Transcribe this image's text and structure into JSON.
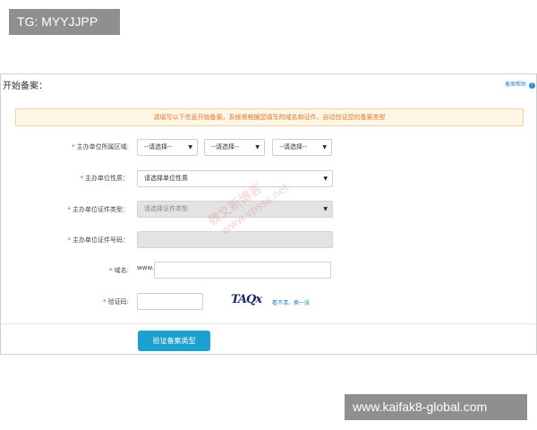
{
  "overlay": {
    "tg_label": "TG: MYYJJPP",
    "site_label": "www.kaifak8-global.com"
  },
  "header": {
    "title": "开始备案：",
    "help_label": "备案帮助",
    "help_icon": "?"
  },
  "notice": {
    "text": "请填写以下信息开始备案，系统将根据您填写的域名和证件，自动验证您的备案类型"
  },
  "form": {
    "required_mark": "*",
    "region": {
      "label": "主办单位所属区域:",
      "selects": [
        "--请选择--",
        "--请选择--",
        "--请选择--"
      ]
    },
    "unit_nature": {
      "label": "主办单位性质：",
      "value": "请选择单位性质"
    },
    "cert_type": {
      "label": "主办单位证件类型：",
      "value": "请选择证件类型"
    },
    "cert_number": {
      "label": "主办单位证件号码：",
      "value": ""
    },
    "domain": {
      "label": "域名:",
      "prefix": "www.",
      "value": ""
    },
    "captcha": {
      "label": "验证码:",
      "value": "",
      "image_text": "TAQx",
      "refresh_label": "看不清，换一张"
    },
    "submit_label": "验证备案类型"
  },
  "watermark": {
    "line1": "魏文新博客",
    "line2": "www.vpsss.net"
  },
  "colors": {
    "accent": "#1ba0cf",
    "required": "#ee3333",
    "notice_text": "#e2782a",
    "notice_bg": "#fdf6e6",
    "link": "#2a7bbd"
  },
  "icons": {
    "dropdown": "chevron-down-icon",
    "help": "question-circle-icon"
  }
}
